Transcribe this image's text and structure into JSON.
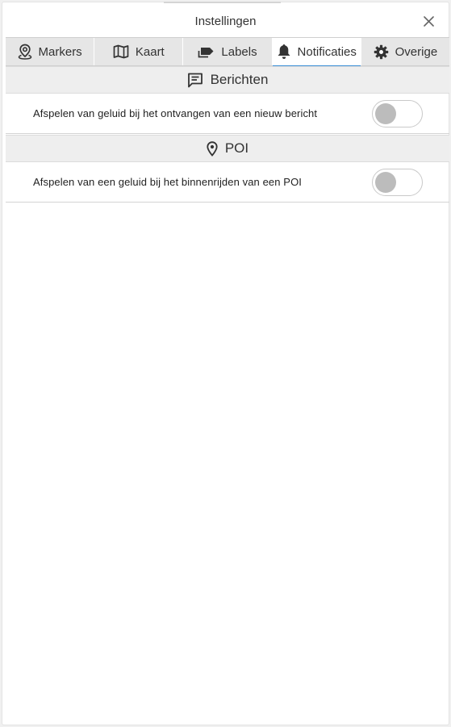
{
  "dialog": {
    "title": "Instellingen",
    "close_icon": "close-icon"
  },
  "tabs": [
    {
      "label": "Markers",
      "icon": "map-pin-icon",
      "active": false
    },
    {
      "label": "Kaart",
      "icon": "map-icon",
      "active": false
    },
    {
      "label": "Labels",
      "icon": "label-tag-icon",
      "active": false
    },
    {
      "label": "Notificaties",
      "icon": "bell-icon",
      "active": true
    },
    {
      "label": "Overige",
      "icon": "gear-icon",
      "active": false
    }
  ],
  "sections": [
    {
      "title": "Berichten",
      "icon": "message-icon",
      "settings": [
        {
          "label": "Afspelen van geluid bij het ontvangen van een nieuw bericht",
          "enabled": false
        }
      ]
    },
    {
      "title": "POI",
      "icon": "location-pin-icon",
      "settings": [
        {
          "label": "Afspelen van een geluid bij het binnenrijden van een POI",
          "enabled": false
        }
      ]
    }
  ],
  "colors": {
    "tab_bar": "#e6e6e6",
    "active_tab_underline": "#3b8fd6",
    "section_header": "#eeeeee",
    "toggle_knob_off": "#bcbcbc"
  }
}
